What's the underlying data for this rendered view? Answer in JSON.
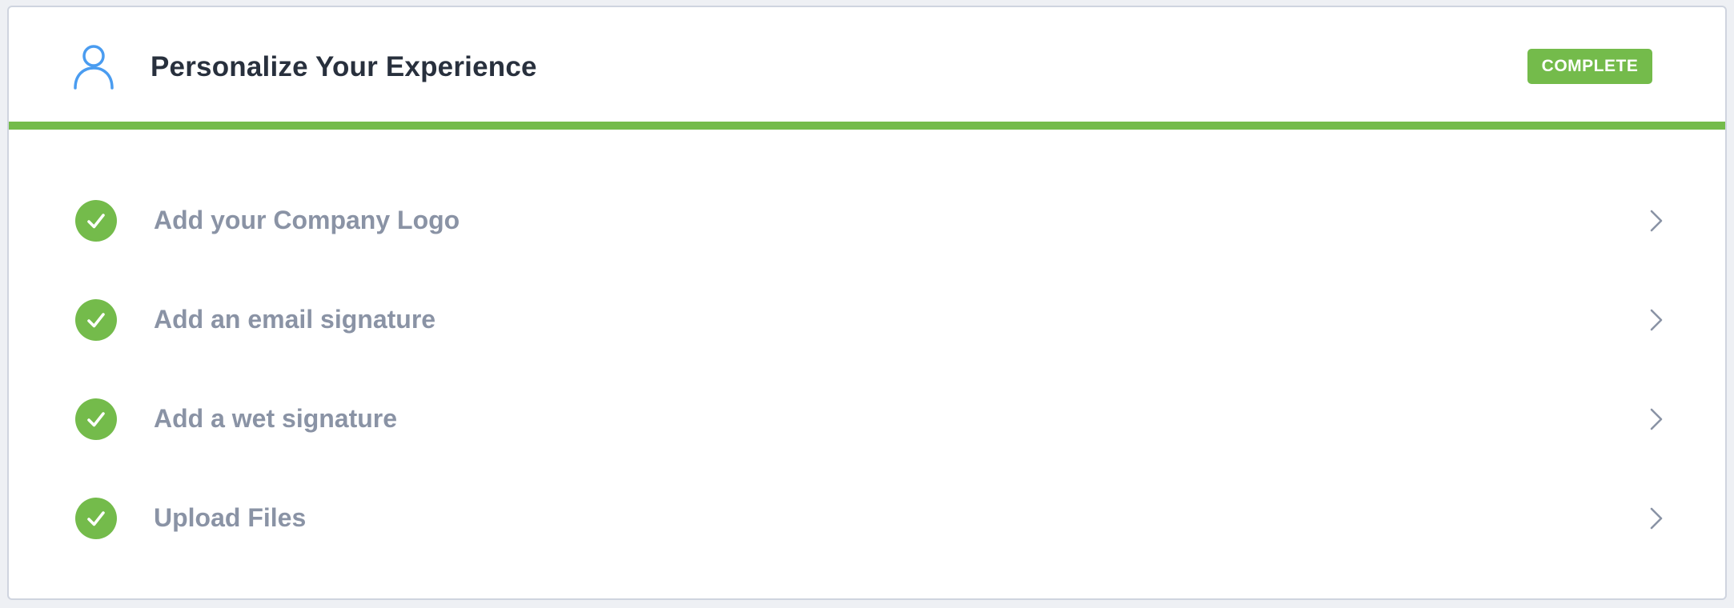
{
  "card": {
    "title": "Personalize Your Experience",
    "title_icon": "user-icon",
    "status": "COMPLETE",
    "progress_fraction": 1.0,
    "colors": {
      "accent_green": "#74bb4b",
      "icon_blue": "#4a9cf0",
      "title_text": "#28303d",
      "item_text": "#8a93a5",
      "chevron": "#8a93a5"
    }
  },
  "tasks": [
    {
      "label": "Add your Company Logo",
      "done": true,
      "status_icon": "checkmark-icon",
      "nav_icon": "chevron-right-icon"
    },
    {
      "label": "Add an email signature",
      "done": true,
      "status_icon": "checkmark-icon",
      "nav_icon": "chevron-right-icon"
    },
    {
      "label": "Add a wet signature",
      "done": true,
      "status_icon": "checkmark-icon",
      "nav_icon": "chevron-right-icon"
    },
    {
      "label": "Upload Files",
      "done": true,
      "status_icon": "checkmark-icon",
      "nav_icon": "chevron-right-icon"
    }
  ]
}
